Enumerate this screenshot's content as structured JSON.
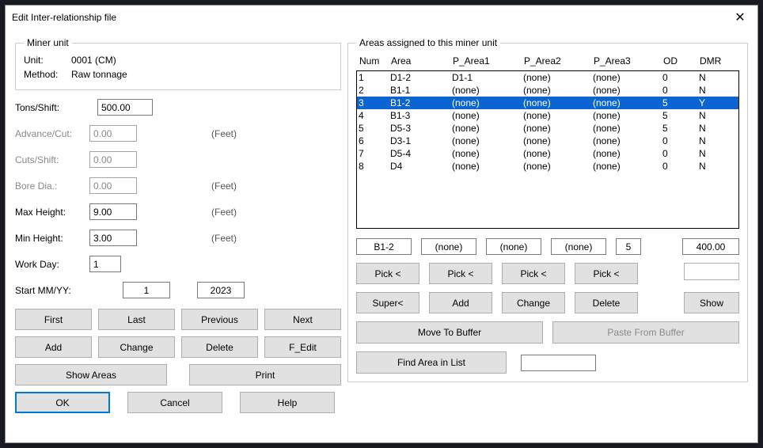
{
  "window": {
    "title": "Edit Inter-relationship file"
  },
  "miner": {
    "legend": "Miner unit",
    "unit_lbl": "Unit:",
    "unit_val": "0001 (CM)",
    "method_lbl": "Method:",
    "method_val": "Raw tonnage"
  },
  "form": {
    "tons_lbl": "Tons/Shift:",
    "tons_val": "500.00",
    "adv_lbl": "Advance/Cut:",
    "adv_val": "0.00",
    "adv_unit": "(Feet)",
    "cuts_lbl": "Cuts/Shift:",
    "cuts_val": "0.00",
    "bore_lbl": "Bore Dia.:",
    "bore_val": "0.00",
    "bore_unit": "(Feet)",
    "maxh_lbl": "Max Height:",
    "maxh_val": "9.00",
    "maxh_unit": "(Feet)",
    "minh_lbl": "Min Height:",
    "minh_val": "3.00",
    "minh_unit": "(Feet)",
    "wday_lbl": "Work Day:",
    "wday_val": "1",
    "start_lbl": "Start MM/YY:",
    "start_mm": "1",
    "start_yy": "2023"
  },
  "btns": {
    "first": "First",
    "last": "Last",
    "prev": "Previous",
    "next": "Next",
    "add": "Add",
    "change": "Change",
    "delete": "Delete",
    "fedit": "F_Edit",
    "showareas": "Show Areas",
    "print": "Print",
    "ok": "OK",
    "cancel": "Cancel",
    "help": "Help"
  },
  "areas": {
    "legend": "Areas assigned to this miner unit",
    "hdr": {
      "num": "Num",
      "area": "Area",
      "p1": "P_Area1",
      "p2": "P_Area2",
      "p3": "P_Area3",
      "od": "OD",
      "dmr": "DMR"
    },
    "rows": [
      {
        "num": "1",
        "area": "D1-2",
        "p1": "D1-1",
        "p2": "(none)",
        "p3": "(none)",
        "od": "0",
        "dmr": "N",
        "sel": false
      },
      {
        "num": "2",
        "area": "B1-1",
        "p1": "(none)",
        "p2": "(none)",
        "p3": "(none)",
        "od": "0",
        "dmr": "N",
        "sel": false
      },
      {
        "num": "3",
        "area": "B1-2",
        "p1": "(none)",
        "p2": "(none)",
        "p3": "(none)",
        "od": "5",
        "dmr": "Y",
        "sel": true
      },
      {
        "num": "4",
        "area": "B1-3",
        "p1": "(none)",
        "p2": "(none)",
        "p3": "(none)",
        "od": "5",
        "dmr": "N",
        "sel": false
      },
      {
        "num": "5",
        "area": "D5-3",
        "p1": "(none)",
        "p2": "(none)",
        "p3": "(none)",
        "od": "5",
        "dmr": "N",
        "sel": false
      },
      {
        "num": "6",
        "area": "D3-1",
        "p1": "(none)",
        "p2": "(none)",
        "p3": "(none)",
        "od": "0",
        "dmr": "N",
        "sel": false
      },
      {
        "num": "7",
        "area": "D5-4",
        "p1": "(none)",
        "p2": "(none)",
        "p3": "(none)",
        "od": "0",
        "dmr": "N",
        "sel": false
      },
      {
        "num": "8",
        "area": "D4",
        "p1": "(none)",
        "p2": "(none)",
        "p3": "(none)",
        "od": "0",
        "dmr": "N",
        "sel": false
      }
    ],
    "edit": {
      "area": "B1-2",
      "p1": "(none)",
      "p2": "(none)",
      "p3": "(none)",
      "od": "5",
      "val": "400.00"
    },
    "pick": "Pick <",
    "super": "Super<",
    "add": "Add",
    "change": "Change",
    "delete": "Delete",
    "show": "Show",
    "movebuf": "Move To Buffer",
    "pastebuf": "Paste From Buffer",
    "find": "Find Area in List"
  }
}
